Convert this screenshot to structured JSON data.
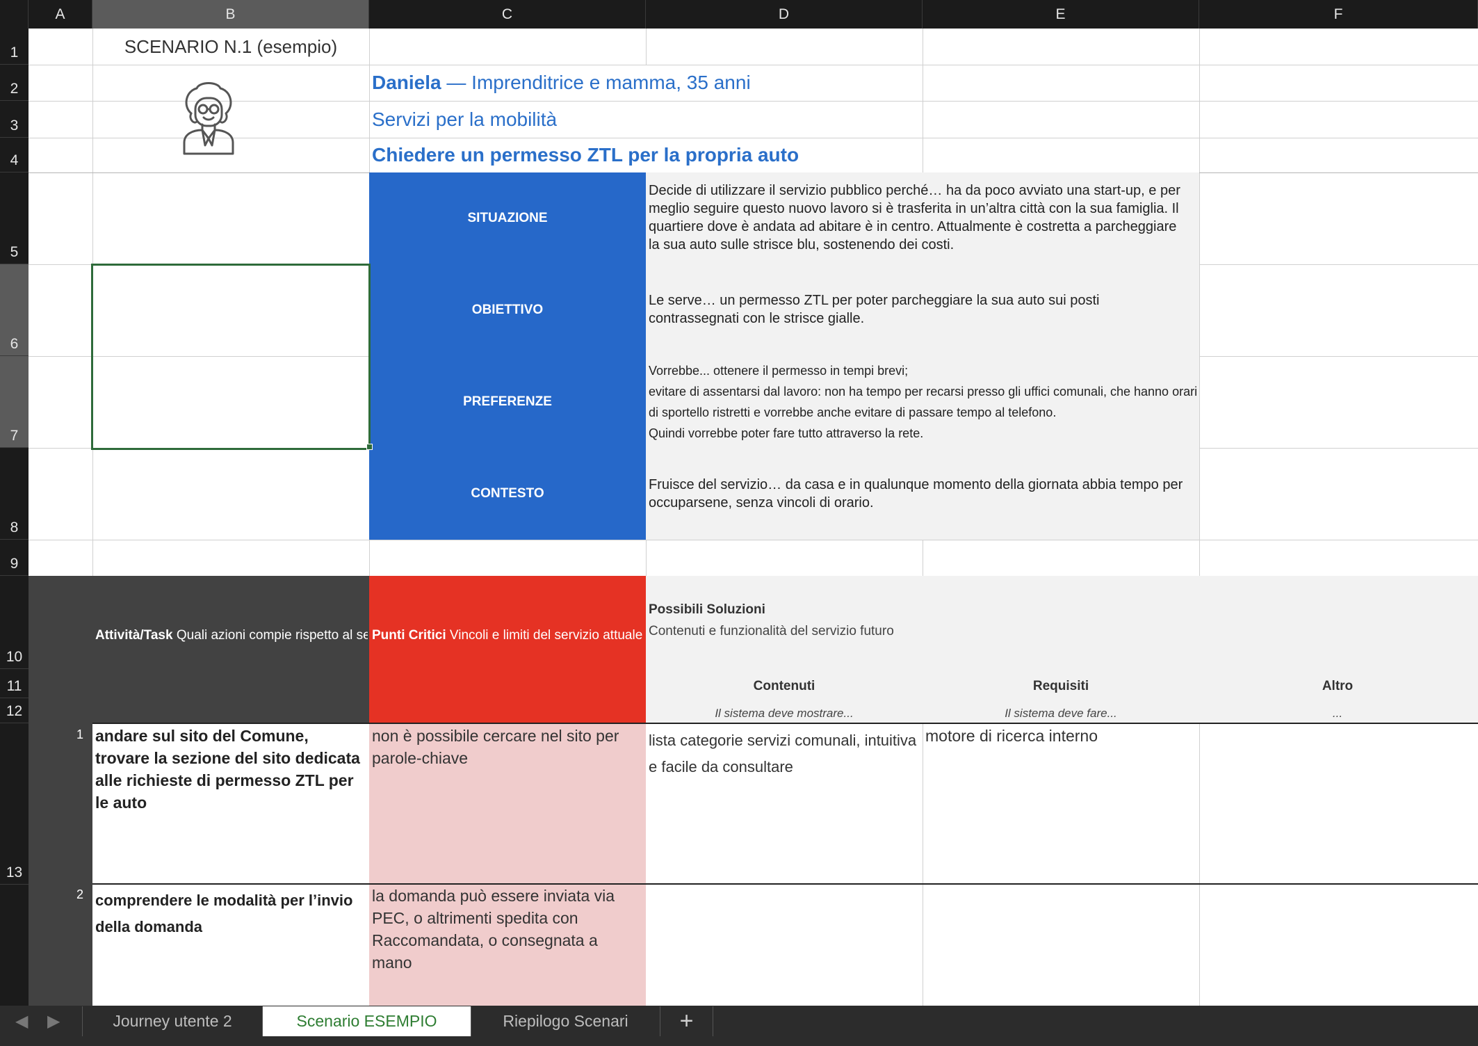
{
  "columns": [
    "A",
    "B",
    "C",
    "D",
    "E",
    "F"
  ],
  "rows": [
    "1",
    "2",
    "3",
    "4",
    "5",
    "6",
    "7",
    "8",
    "9",
    "10",
    "11",
    "12",
    "13"
  ],
  "task_rows": [
    "1",
    "2"
  ],
  "header": {
    "scenario": "SCENARIO N.1 (esempio)",
    "persona_name": "Daniela",
    "persona_desc": " — Imprenditrice e mamma, 35 anni",
    "service": "Servizi per la mobilità",
    "goal": "Chiedere un permesso ZTL per la propria auto"
  },
  "persona_avatar_icon": "person-avatar-icon",
  "sections": [
    {
      "label": "SITUAZIONE",
      "text": "Decide di utilizzare il servizio pubblico perché… ha da poco avviato una start-up, e per meglio seguire questo nuovo lavoro si è trasferita in un’altra città con la sua famiglia. Il quartiere dove è andata ad abitare è in centro. Attualmente è costretta a parcheggiare la sua auto sulle strisce blu, sostenendo dei costi."
    },
    {
      "label": "OBIETTIVO",
      "text": "Le serve… un  permesso ZTL per poter parcheggiare la sua auto sui posti contrassegnati con le strisce gialle."
    },
    {
      "label": "PREFERENZE",
      "lines": [
        "Vorrebbe... ottenere il permesso in tempi brevi;",
        "evitare di assentarsi dal lavoro: non ha tempo per recarsi presso gli uffici comunali, che hanno orari di sportello ristretti e vorrebbe anche evitare di passare tempo al telefono.",
        "Quindi vorrebbe poter fare tutto attraverso la rete."
      ]
    },
    {
      "label": "CONTESTO",
      "text": "Fruisce del servizio… da casa e in qualunque momento della giornata abbia tempo per occuparsene, senza vincoli di orario."
    }
  ],
  "table": {
    "task_header_bold": "Attività/Task",
    "task_header_rest": " Quali azioni compie rispetto al servizio",
    "crit_header_bold": "Punti Critici",
    "crit_header_rest": " Vincoli e limiti del servizio attuale",
    "sol_title": "Possibili Soluzioni",
    "sol_sub": "Contenuti e funzionalità del servizio futuro",
    "col_contenuti": "Contenuti",
    "col_requisiti": "Requisiti",
    "col_altro": "Altro",
    "hint_contenuti": "Il sistema deve mostrare...",
    "hint_requisiti": "Il sistema deve fare...",
    "hint_altro": "...",
    "rows": [
      {
        "task": "andare sul sito del Comune, trovare la sezione del sito dedicata alle richieste di permesso ZTL per le auto",
        "crit": "non è possibile cercare nel sito per parole-chiave",
        "contenuti": "lista categorie servizi comunali, intuitiva e facile da consultare",
        "requisiti": "motore di ricerca interno",
        "altro": ""
      },
      {
        "task": "comprendere le modalità per l’invio della domanda",
        "crit": "la domanda può essere inviata via PEC, o altrimenti spedita con Raccomandata, o consegnata a mano",
        "contenuti": "",
        "requisiti": "",
        "altro": ""
      }
    ]
  },
  "tabs": [
    "Journey utente 2",
    "Scenario ESEMPIO",
    "Riepilogo Scenari"
  ],
  "add_sheet": "+",
  "nav": {
    "prev": "◀",
    "next": "▶"
  },
  "colors": {
    "blue": "#2668c9",
    "red": "#e53224",
    "pink": "#f0cccc",
    "dark": "#424242",
    "grey": "#f2f2f2",
    "active_tab": "#2e7d32"
  }
}
